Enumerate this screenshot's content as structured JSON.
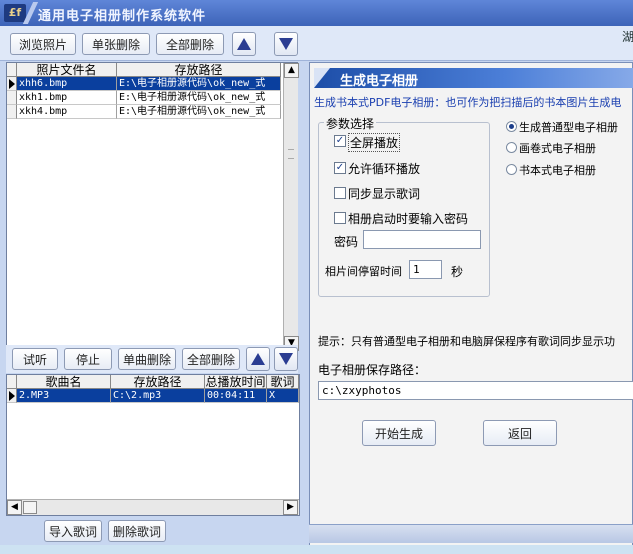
{
  "app": {
    "title": "通用电子相册制作系统软件",
    "logo_text": "£f",
    "top_right_text": "湖"
  },
  "photo_toolbar": {
    "browse": "浏览照片",
    "delete_one": "单张删除",
    "delete_all": "全部删除",
    "up_icon": "arrow-up-icon",
    "down_icon": "arrow-down-icon"
  },
  "photo_table": {
    "headers": [
      "照片文件名",
      "存放路径"
    ],
    "rows": [
      {
        "name": "xhh6.bmp",
        "path": "E:\\电子相册源代码\\ok_new_式",
        "selected": true
      },
      {
        "name": "xkh1.bmp",
        "path": "E:\\电子相册源代码\\ok_new_式",
        "selected": false
      },
      {
        "name": "xkh4.bmp",
        "path": "E:\\电子相册源代码\\ok_new_式",
        "selected": false
      }
    ]
  },
  "music_toolbar": {
    "preview": "试听",
    "stop": "停止",
    "delete_one": "单曲删除",
    "delete_all": "全部删除"
  },
  "music_table": {
    "headers": [
      "歌曲名",
      "存放路径",
      "总播放时间",
      "歌词"
    ],
    "rows": [
      {
        "name": "2.MP3",
        "path": "C:\\2.mp3",
        "duration": "00:04:11",
        "lyrics": "X",
        "selected": true
      }
    ]
  },
  "lyrics_buttons": {
    "import": "导入歌词",
    "delete": "删除歌词"
  },
  "album_panel": {
    "title": "生成电子相册",
    "description": "生成书本式PDF电子相册：也可作为把扫描后的书本图片生成电",
    "params_legend": "参数选择",
    "options": {
      "fullscreen": {
        "label": "全屏播放",
        "checked": true
      },
      "loop": {
        "label": "允许循环播放",
        "checked": true
      },
      "sync_lyrics": {
        "label": "同步显示歌词",
        "checked": false
      },
      "password_on_start": {
        "label": "相册启动时要输入密码",
        "checked": false
      }
    },
    "password_label": "密码",
    "password_value": "",
    "interval_label": "相片间停留时间",
    "interval_value": "1",
    "interval_unit": "秒",
    "album_types": [
      {
        "label": "生成普通型电子相册",
        "selected": true
      },
      {
        "label": "画卷式电子相册",
        "selected": false
      },
      {
        "label": "书本式电子相册",
        "selected": false
      }
    ],
    "hint": "提示：只有普通型电子相册和电脑屏保程序有歌词同步显示功",
    "save_path_label": "电子相册保存路径：",
    "save_path_value": "c:\\zxyphotos",
    "generate_button": "开始生成",
    "back_button": "返回"
  },
  "colors": {
    "selection": "#0a3f9e",
    "title_bar": "#3d63b8",
    "panel_title": "#1d4ea8",
    "accent_blue": "#1a3fb0"
  }
}
